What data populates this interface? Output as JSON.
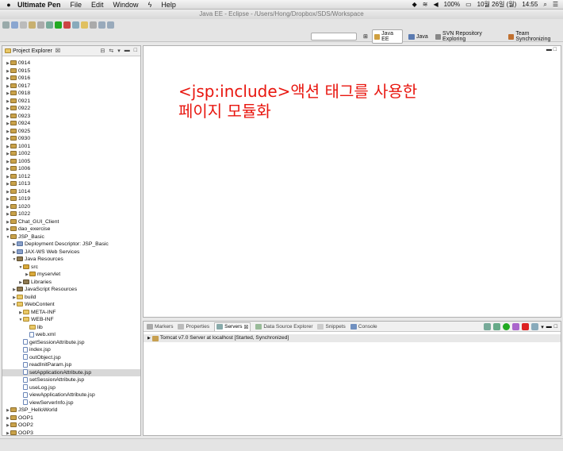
{
  "menubar": {
    "app": "Ultimate Pen",
    "items": [
      "File",
      "Edit",
      "Window",
      "Help"
    ],
    "battery": "100%",
    "date": "10월 26일 (월)",
    "time": "14:55"
  },
  "window_title": "Java EE - Eclipse - /Users/Hong/Dropbox/SDS/Workspace",
  "perspectives": [
    "Java EE",
    "Java",
    "SVN Repository Exploring",
    "Team Synchronizing"
  ],
  "explorer": {
    "tab_label": "Project Explorer",
    "tab_close": "☒",
    "rows": [
      {
        "label": "0914",
        "icon": "proj",
        "arrow": "▶",
        "indent": 0
      },
      {
        "label": "0915",
        "icon": "proj",
        "arrow": "▶",
        "indent": 0
      },
      {
        "label": "0916",
        "icon": "proj",
        "arrow": "▶",
        "indent": 0
      },
      {
        "label": "0917",
        "icon": "proj",
        "arrow": "▶",
        "indent": 0
      },
      {
        "label": "0918",
        "icon": "proj",
        "arrow": "▶",
        "indent": 0
      },
      {
        "label": "0921",
        "icon": "proj",
        "arrow": "▶",
        "indent": 0
      },
      {
        "label": "0922",
        "icon": "proj",
        "arrow": "▶",
        "indent": 0
      },
      {
        "label": "0923",
        "icon": "proj",
        "arrow": "▶",
        "indent": 0
      },
      {
        "label": "0924",
        "icon": "proj",
        "arrow": "▶",
        "indent": 0
      },
      {
        "label": "0925",
        "icon": "proj",
        "arrow": "▶",
        "indent": 0
      },
      {
        "label": "0930",
        "icon": "proj",
        "arrow": "▶",
        "indent": 0
      },
      {
        "label": "1001",
        "icon": "proj",
        "arrow": "▶",
        "indent": 0
      },
      {
        "label": "1002",
        "icon": "proj",
        "arrow": "▶",
        "indent": 0
      },
      {
        "label": "1005",
        "icon": "proj",
        "arrow": "▶",
        "indent": 0
      },
      {
        "label": "1006",
        "icon": "proj",
        "arrow": "▶",
        "indent": 0
      },
      {
        "label": "1012",
        "icon": "proj",
        "arrow": "▶",
        "indent": 0
      },
      {
        "label": "1013",
        "icon": "proj",
        "arrow": "▶",
        "indent": 0
      },
      {
        "label": "1014",
        "icon": "proj",
        "arrow": "▶",
        "indent": 0
      },
      {
        "label": "1019",
        "icon": "proj",
        "arrow": "▶",
        "indent": 0
      },
      {
        "label": "1020",
        "icon": "proj",
        "arrow": "▶",
        "indent": 0
      },
      {
        "label": "1022",
        "icon": "proj",
        "arrow": "▶",
        "indent": 0
      },
      {
        "label": "Chat_GUI_Client",
        "icon": "proj",
        "arrow": "▶",
        "indent": 0
      },
      {
        "label": "dao_exercise",
        "icon": "proj",
        "arrow": "▶",
        "indent": 0
      },
      {
        "label": "JSP_Basic",
        "icon": "proj",
        "arrow": "▼",
        "indent": 0
      },
      {
        "label": "Deployment Descriptor: JSP_Basic",
        "icon": "misc",
        "arrow": "▶",
        "indent": 1
      },
      {
        "label": "JAX-WS Web Services",
        "icon": "misc",
        "arrow": "▶",
        "indent": 1
      },
      {
        "label": "Java Resources",
        "icon": "lib",
        "arrow": "▼",
        "indent": 1
      },
      {
        "label": "src",
        "icon": "pkg",
        "arrow": "▼",
        "indent": 2
      },
      {
        "label": "myservlet",
        "icon": "pkg",
        "arrow": "▶",
        "indent": 3
      },
      {
        "label": "Libraries",
        "icon": "lib",
        "arrow": "▶",
        "indent": 2
      },
      {
        "label": "JavaScript Resources",
        "icon": "lib",
        "arrow": "▶",
        "indent": 1
      },
      {
        "label": "build",
        "icon": "folder",
        "arrow": "▶",
        "indent": 1
      },
      {
        "label": "WebContent",
        "icon": "folder",
        "arrow": "▼",
        "indent": 1
      },
      {
        "label": "META-INF",
        "icon": "folder",
        "arrow": "▶",
        "indent": 2
      },
      {
        "label": "WEB-INF",
        "icon": "folder",
        "arrow": "▼",
        "indent": 2
      },
      {
        "label": "lib",
        "icon": "folder",
        "arrow": "",
        "indent": 3
      },
      {
        "label": "web.xml",
        "icon": "file",
        "arrow": "",
        "indent": 3
      },
      {
        "label": "getSessionAttribute.jsp",
        "icon": "file",
        "arrow": "",
        "indent": 2
      },
      {
        "label": "index.jsp",
        "icon": "file",
        "arrow": "",
        "indent": 2
      },
      {
        "label": "outObject.jsp",
        "icon": "file",
        "arrow": "",
        "indent": 2
      },
      {
        "label": "readInitParam.jsp",
        "icon": "file",
        "arrow": "",
        "indent": 2
      },
      {
        "label": "setApplicationAttribute.jsp",
        "icon": "file",
        "arrow": "",
        "indent": 2,
        "selected": true
      },
      {
        "label": "setSessionAttribute.jsp",
        "icon": "file",
        "arrow": "",
        "indent": 2
      },
      {
        "label": "useLog.jsp",
        "icon": "file",
        "arrow": "",
        "indent": 2
      },
      {
        "label": "viewApplicationAttribute.jsp",
        "icon": "file",
        "arrow": "",
        "indent": 2
      },
      {
        "label": "viewServerInfo.jsp",
        "icon": "file",
        "arrow": "",
        "indent": 2
      },
      {
        "label": "JSP_HelloWorld",
        "icon": "proj",
        "arrow": "▶",
        "indent": 0
      },
      {
        "label": "OOP1",
        "icon": "proj",
        "arrow": "▶",
        "indent": 0
      },
      {
        "label": "OOP2",
        "icon": "proj",
        "arrow": "▶",
        "indent": 0
      },
      {
        "label": "OOP3",
        "icon": "proj",
        "arrow": "▶",
        "indent": 0
      }
    ]
  },
  "overlay": {
    "line1": "<jsp:include>액션 태그를 사용한",
    "line2": "페이지 모듈화"
  },
  "bottom": {
    "tabs": [
      {
        "label": "Markers",
        "active": false
      },
      {
        "label": "Properties",
        "active": false
      },
      {
        "label": "Servers",
        "active": true
      },
      {
        "label": "Data Source Explorer",
        "active": false
      },
      {
        "label": "Snippets",
        "active": false
      },
      {
        "label": "Console",
        "active": false
      }
    ],
    "server_row": "Tomcat v7.0 Server at localhost  [Started, Synchronized]"
  },
  "colors": {
    "overlay": "#e8160f",
    "selection": "#d8d8d8"
  }
}
